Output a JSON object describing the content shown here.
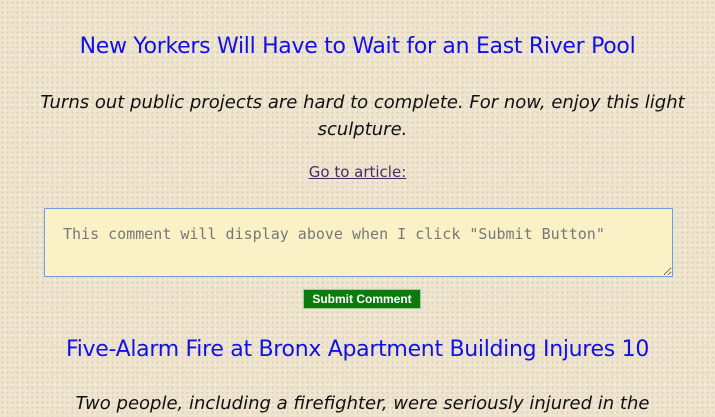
{
  "articles": [
    {
      "title": "New Yorkers Will Have to Wait for an East River Pool",
      "subtitle": "Turns out public projects are hard to complete. For now, enjoy this light sculpture.",
      "link_label": "Go to article:"
    },
    {
      "title": "Five-Alarm Fire at Bronx Apartment Building Injures 10",
      "subtitle": "Two people, including a firefighter, were seriously injured in the"
    }
  ],
  "comment": {
    "placeholder": "This comment will display above when I click \"Submit Button\"",
    "value": "",
    "submit_label": "Submit Comment"
  },
  "colors": {
    "title": "#1111e6",
    "button": "#0c7a0c",
    "textarea_bg": "#fbf1c6",
    "background": "#efe5cf"
  }
}
